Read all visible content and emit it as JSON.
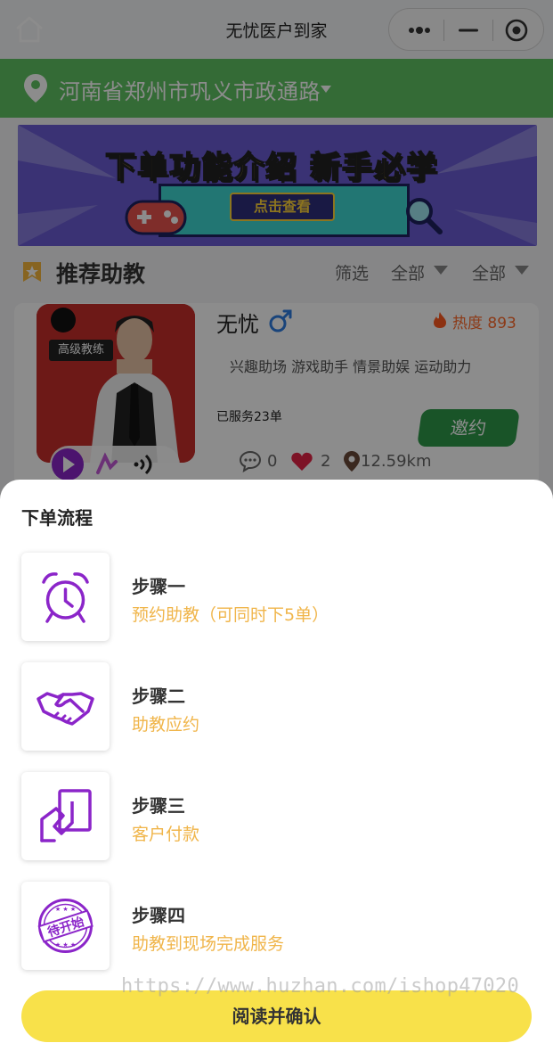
{
  "app": {
    "title": "无忧医户到家"
  },
  "location": {
    "text": "河南省郑州市巩义市政通路"
  },
  "banner": {
    "title": "下单功能介绍 新手必学",
    "button": "点击查看"
  },
  "recommend": {
    "title": "推荐助教",
    "filters": [
      "筛选",
      "全部",
      "全部"
    ]
  },
  "coach": {
    "badge": "高级教练",
    "name": "无忧",
    "heat": "热度 893",
    "tags": "兴趣助场 游戏助手 情景助娱 运动助力",
    "served": "已服务23单",
    "invite": "邀约",
    "comments": "0",
    "likes": "2",
    "distance": "12.59km"
  },
  "sheet": {
    "title": "下单流程",
    "steps": [
      {
        "name": "步骤一",
        "desc": "预约助教（可同时下5单）",
        "icon": "alarm-clock-icon"
      },
      {
        "name": "步骤二",
        "desc": "助教应约",
        "icon": "handshake-icon"
      },
      {
        "name": "步骤三",
        "desc": "客户付款",
        "icon": "payment-icon"
      },
      {
        "name": "步骤四",
        "desc": "助教到现场完成服务",
        "icon": "start-stamp-icon"
      }
    ],
    "stamp_text": "待开始",
    "confirm": "阅读并确认"
  },
  "watermark": "https://www.huzhan.com/ishop47020",
  "colors": {
    "location_bar": "#60c463",
    "accent_orange": "#f0b54a",
    "confirm_button": "#f8e14a",
    "icon_purple": "#8b25c9"
  }
}
